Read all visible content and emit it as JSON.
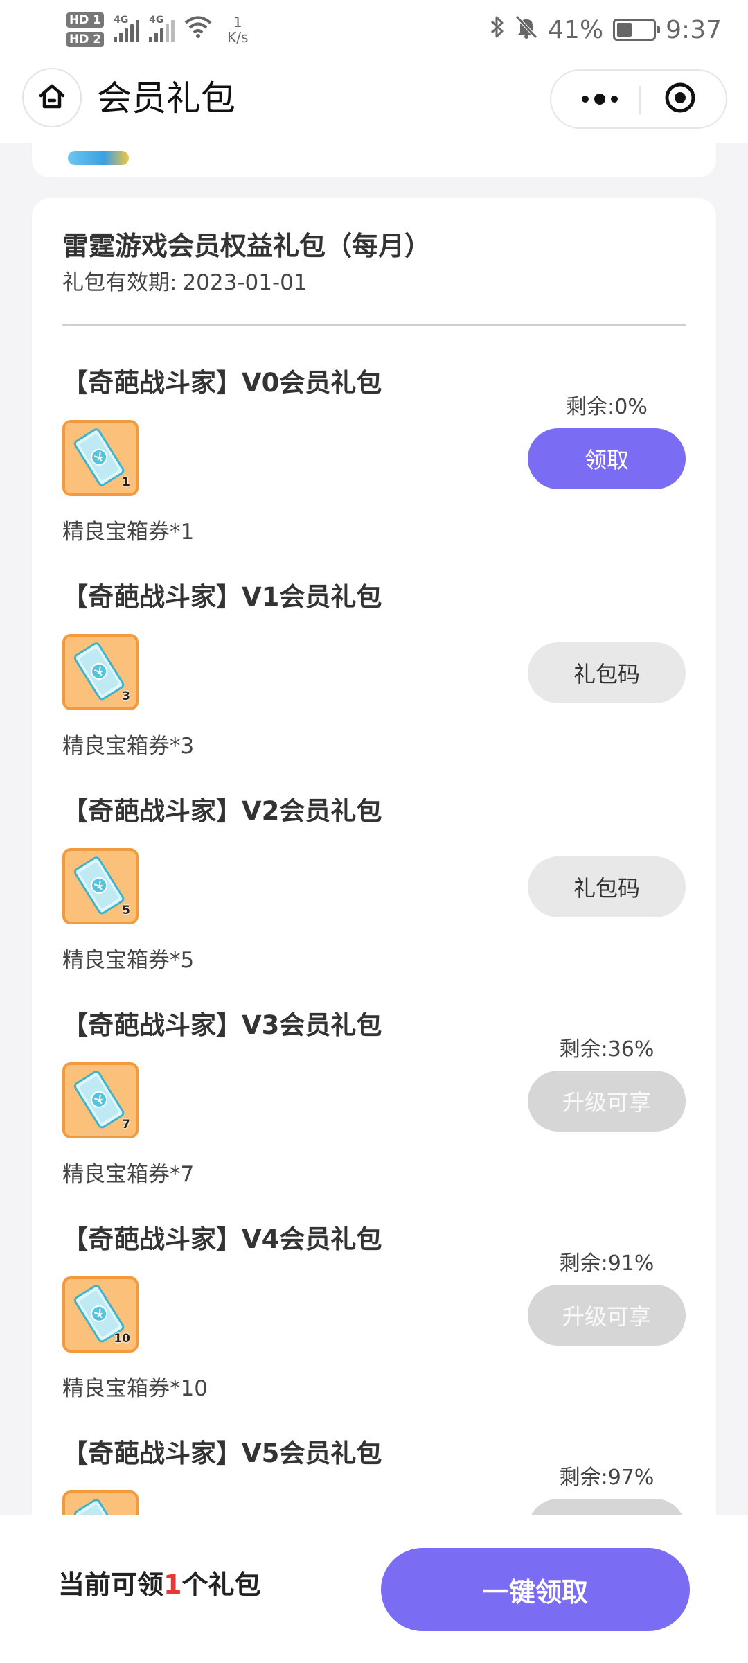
{
  "status_bar": {
    "hd1": "HD 1",
    "hd2": "HD 2",
    "net1": "4G",
    "net2": "4G",
    "speed_value": "1",
    "speed_unit": "K/s",
    "battery_text": "41%",
    "battery_level": 0.41,
    "time": "9:37",
    "icons": [
      "signal-icon",
      "wifi-icon",
      "bluetooth-icon",
      "mute-icon",
      "battery-icon"
    ]
  },
  "nav": {
    "title": "会员礼包",
    "icons": [
      "home-icon",
      "more-icon",
      "target-icon"
    ]
  },
  "section": {
    "title": "雷霆游戏会员权益礼包（每月）",
    "valid_label": "礼包有效期:",
    "valid_date": "2023-01-01"
  },
  "gifts": [
    {
      "title": "【奇葩战斗家】V0会员礼包",
      "item": "精良宝箱券*1",
      "qty": "1",
      "remain": "剩余:0%",
      "button": "领取",
      "state": "claim"
    },
    {
      "title": "【奇葩战斗家】V1会员礼包",
      "item": "精良宝箱券*3",
      "qty": "3",
      "remain": "",
      "button": "礼包码",
      "state": "code"
    },
    {
      "title": "【奇葩战斗家】V2会员礼包",
      "item": "精良宝箱券*5",
      "qty": "5",
      "remain": "",
      "button": "礼包码",
      "state": "code"
    },
    {
      "title": "【奇葩战斗家】V3会员礼包",
      "item": "精良宝箱券*7",
      "qty": "7",
      "remain": "剩余:36%",
      "button": "升级可享",
      "state": "upgrade"
    },
    {
      "title": "【奇葩战斗家】V4会员礼包",
      "item": "精良宝箱券*10",
      "qty": "10",
      "remain": "剩余:91%",
      "button": "升级可享",
      "state": "upgrade"
    },
    {
      "title": "【奇葩战斗家】V5会员礼包",
      "item": "",
      "qty": "",
      "remain": "剩余:97%",
      "button": "",
      "state": "upgrade"
    }
  ],
  "bottom": {
    "prefix": "当前可领",
    "count": "1",
    "suffix": "个礼包",
    "button": "一键领取"
  },
  "colors": {
    "accent": "#7a6cf3",
    "highlight": "#e53935",
    "icon_bg": "#fbc07a",
    "icon_border": "#f39a3d"
  }
}
